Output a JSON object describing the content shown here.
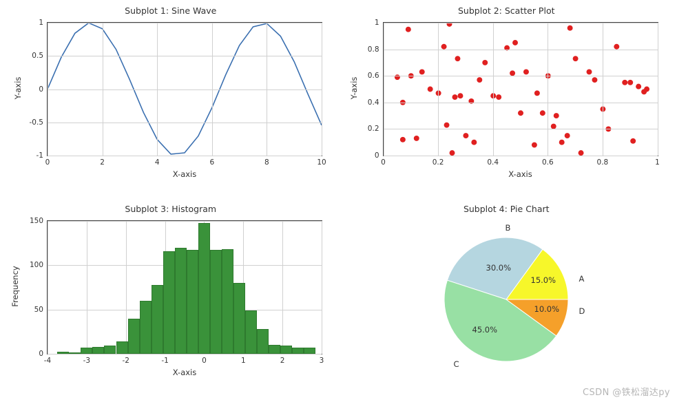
{
  "chart_data": [
    {
      "type": "line",
      "title": "Subplot 1: Sine Wave",
      "xlabel": "X-axis",
      "ylabel": "Y-axis",
      "xlim": [
        0,
        10
      ],
      "ylim": [
        -1.0,
        1.0
      ],
      "x_ticks": [
        0,
        2,
        4,
        6,
        8,
        10
      ],
      "y_ticks": [
        -1.0,
        -0.5,
        0.0,
        0.5,
        1.0
      ],
      "x": [
        0,
        0.5,
        1,
        1.5,
        2,
        2.5,
        3,
        3.5,
        4,
        4.5,
        5,
        5.5,
        6,
        6.5,
        7,
        7.5,
        8,
        8.5,
        9,
        9.5,
        10
      ],
      "y": [
        0.0,
        0.479,
        0.841,
        0.997,
        0.909,
        0.599,
        0.141,
        -0.351,
        -0.757,
        -0.978,
        -0.959,
        -0.706,
        -0.279,
        0.215,
        0.657,
        0.938,
        0.989,
        0.798,
        0.412,
        -0.075,
        -0.544
      ],
      "color": "#3a6fb0"
    },
    {
      "type": "scatter",
      "title": "Subplot 2: Scatter Plot",
      "xlabel": "X-axis",
      "ylabel": "Y-axis",
      "xlim": [
        0.0,
        1.0
      ],
      "ylim": [
        0.0,
        1.0
      ],
      "x_ticks": [
        0.0,
        0.2,
        0.4,
        0.6,
        0.8,
        1.0
      ],
      "y_ticks": [
        0.0,
        0.2,
        0.4,
        0.6,
        0.8,
        1.0
      ],
      "x": [
        0.05,
        0.07,
        0.07,
        0.09,
        0.1,
        0.12,
        0.14,
        0.17,
        0.2,
        0.22,
        0.23,
        0.24,
        0.25,
        0.26,
        0.27,
        0.28,
        0.3,
        0.32,
        0.33,
        0.35,
        0.37,
        0.4,
        0.42,
        0.45,
        0.47,
        0.48,
        0.5,
        0.52,
        0.55,
        0.56,
        0.58,
        0.6,
        0.62,
        0.63,
        0.65,
        0.67,
        0.68,
        0.7,
        0.72,
        0.75,
        0.77,
        0.8,
        0.82,
        0.85,
        0.88,
        0.9,
        0.91,
        0.93,
        0.95,
        0.96
      ],
      "y": [
        0.59,
        0.12,
        0.4,
        0.95,
        0.6,
        0.13,
        0.63,
        0.5,
        0.47,
        0.82,
        0.23,
        0.99,
        0.02,
        0.44,
        0.73,
        0.45,
        0.15,
        0.41,
        0.1,
        0.57,
        0.7,
        0.45,
        0.44,
        0.81,
        0.62,
        0.85,
        0.32,
        0.63,
        0.08,
        0.47,
        0.32,
        0.6,
        0.22,
        0.3,
        0.1,
        0.15,
        0.96,
        0.73,
        0.02,
        0.63,
        0.57,
        0.35,
        0.2,
        0.82,
        0.55,
        0.55,
        0.11,
        0.52,
        0.48,
        0.5
      ],
      "color": "#e02020"
    },
    {
      "type": "bar",
      "title": "Subplot 3: Histogram",
      "xlabel": "X-axis",
      "ylabel": "Frequency",
      "xlim": [
        -4,
        3
      ],
      "ylim": [
        0,
        150
      ],
      "x_ticks": [
        -4,
        -3,
        -2,
        -1,
        0,
        1,
        2,
        3
      ],
      "y_ticks": [
        0,
        50,
        100,
        150
      ],
      "bin_edges": [
        -3.75,
        -3.45,
        -3.15,
        -2.85,
        -2.55,
        -2.25,
        -1.95,
        -1.65,
        -1.35,
        -1.05,
        -0.75,
        -0.45,
        -0.15,
        0.15,
        0.45,
        0.75,
        1.05,
        1.35,
        1.65,
        1.95,
        2.25,
        2.55,
        2.85
      ],
      "counts": [
        2,
        0,
        7,
        8,
        9,
        14,
        40,
        60,
        78,
        116,
        120,
        117,
        148,
        117,
        118,
        80,
        49,
        28,
        10,
        9,
        7,
        7
      ],
      "color": "#3a923a"
    },
    {
      "type": "pie",
      "title": "Subplot 4: Pie Chart",
      "labels": [
        "A",
        "B",
        "C",
        "D"
      ],
      "values": [
        15.0,
        30.0,
        45.0,
        10.0
      ],
      "colors": [
        "#f7f72a",
        "#b5d6e0",
        "#98e0a4",
        "#f5a02a"
      ],
      "label_text": {
        "A": "15.0%",
        "B": "30.0%",
        "C": "45.0%",
        "D": "10.0%"
      }
    }
  ],
  "watermark": "CSDN @铁松溜达py"
}
